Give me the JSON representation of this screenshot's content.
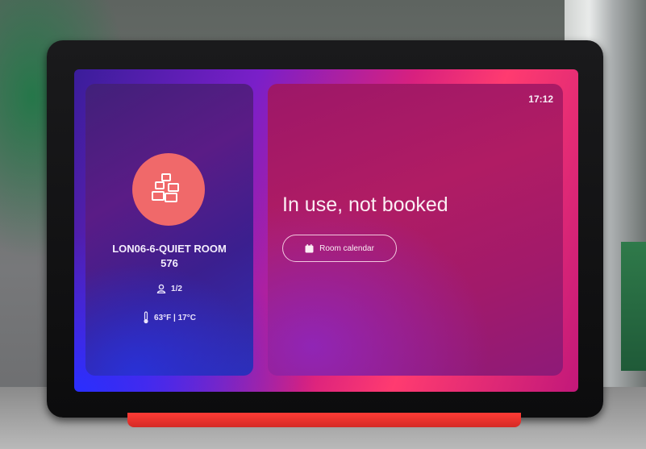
{
  "device": {
    "time": "17:12",
    "room": {
      "name_line1": "LON06-6-QUIET ROOM",
      "name_line2": "576",
      "occupancy": "1/2",
      "temperature": "63°F | 17°C",
      "avatar_color": "#f0696a"
    },
    "status": {
      "text": "In use, not booked",
      "calendar_button_label": "Room calendar"
    }
  }
}
